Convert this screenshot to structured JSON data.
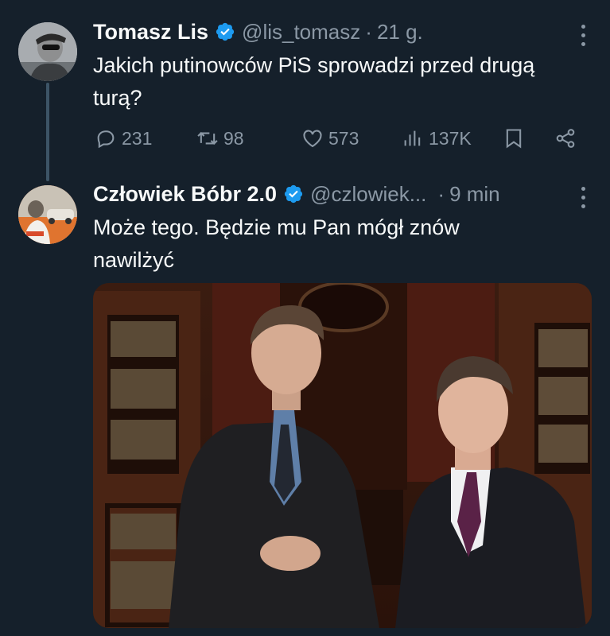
{
  "tweet1": {
    "name": "Tomasz Lis",
    "handle": "@lis_tomasz",
    "separator": "·",
    "time": "21 g.",
    "text": "Jakich putinowców  PiS sprowadzi przed drugą turą?",
    "replies": "231",
    "retweets": "98",
    "likes": "573",
    "views": "137K"
  },
  "tweet2": {
    "name": "Człowiek Bóbr 2.0",
    "handle": "@czlowiek...",
    "separator": "·",
    "time": "9 min",
    "text": "Może tego. Będzie mu Pan mógł znów nawilżyć"
  },
  "colors": {
    "background": "#15202b",
    "text": "#f7f9f9",
    "secondary": "#8b98a5",
    "verified": "#1d9bf0"
  }
}
